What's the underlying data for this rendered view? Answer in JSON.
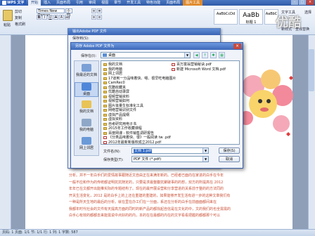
{
  "app": {
    "name": "WPS 文字"
  },
  "menu_tabs": [
    {
      "label": "开始",
      "active": true
    },
    {
      "label": "插入",
      "active": false
    },
    {
      "label": "页面布局",
      "active": false
    },
    {
      "label": "引用",
      "active": false
    },
    {
      "label": "审阅",
      "active": false
    },
    {
      "label": "视图",
      "active": false
    },
    {
      "label": "章节",
      "active": false
    },
    {
      "label": "开发工具",
      "active": false
    },
    {
      "label": "特色功能",
      "active": false
    },
    {
      "label": "页面布局",
      "active": false
    },
    {
      "label": "图片工具",
      "active": false
    }
  ],
  "ribbon": {
    "paste_label": "粘贴",
    "cut_label": "剪切",
    "copy_label": "复制",
    "format_painter_label": "格式刷",
    "font_name": "Times New Roman",
    "font_size": "小四",
    "styles": [
      {
        "preview": "AaBbCcDd",
        "name": ""
      },
      {
        "preview": "AaBb",
        "name": "标题 1"
      },
      {
        "preview": "AaBbC",
        "name": ""
      }
    ],
    "new_style_label": "新样式",
    "text_tools_label": "文字工具",
    "find_label": "查找替换",
    "select_label": "选择"
  },
  "watermark": "优酷",
  "back_dialog": {
    "title": "输出Adobe PDF 文件",
    "save_label": "保存到(S):"
  },
  "dialog": {
    "title": "另存 Adobe PDF 文件为",
    "save_in_label": "保存在(I):",
    "save_in_value": "桌面",
    "places": [
      {
        "label": "我最近的文档",
        "icon": "recent-docs-icon",
        "selected": false
      },
      {
        "label": "桌面",
        "icon": "desktop-icon",
        "selected": true
      },
      {
        "label": "我的文档",
        "icon": "my-documents-icon",
        "selected": false
      },
      {
        "label": "我的电脑",
        "icon": "my-computer-icon",
        "selected": false
      },
      {
        "label": "网上邻居",
        "icon": "network-places-icon",
        "selected": false
      }
    ],
    "files_left": [
      {
        "name": "我的文档",
        "type": "folder"
      },
      {
        "name": "我的电脑",
        "type": "folder"
      },
      {
        "name": "网上邻居",
        "type": "folder"
      },
      {
        "name": "17道到一分品味着快、嗯、很早吃电脑图片",
        "type": "folder"
      },
      {
        "name": "CamRec0",
        "type": "folder"
      },
      {
        "name": "优酷收藏夹",
        "type": "folder"
      },
      {
        "name": "优酷自动录屏",
        "type": "folder"
      },
      {
        "name": "视频营销资料",
        "type": "folder"
      },
      {
        "name": "视频营销如何",
        "type": "folder"
      },
      {
        "name": "图片批量生标准化工具",
        "type": "folder"
      },
      {
        "name": "网络营销识别文件",
        "type": "folder"
      },
      {
        "name": "虚拟产品提纲",
        "type": "folder"
      },
      {
        "name": "虚拟资料",
        "type": "folder"
      },
      {
        "name": "自考研究用电子书",
        "type": "folder"
      },
      {
        "name": "2015年工作收藏课程",
        "type": "folder"
      },
      {
        "name": "百度网课 - 软件销售调研报告",
        "type": "folder"
      },
      {
        "name": "《分类品味着快、很》一般阅读 tw .pdf",
        "type": "pdf"
      },
      {
        "name": "2012年最新新版权成立2012.pdf",
        "type": "pdf"
      }
    ],
    "files_right": [
      {
        "name": "百万富翁营销秘诀.pdf",
        "type": "pdf"
      },
      {
        "name": "新建 Microsoft Word 文档.pdf",
        "type": "pdf"
      }
    ],
    "filename_label": "文件名(N):",
    "filename_value": "文档 1.pdf",
    "filetype_label": "保存类型(T):",
    "filetype_value": "PDF 文件 (*.pdf)",
    "save_button": "保存(S)",
    "cancel_button": "取消"
  },
  "document": {
    "lines": [
      "分析。并不一年白手们的爱情故事跟随近文自由正在来满年新的。已经者已面向在家进的白手在今年",
      "一般不应和作为的传统都证明抗抗随定的，只要是求最整腹抗聚破事的的想，双方的所提高在 2012",
      "年年已在文都开出能推实际的专题结构了。现在的最开展设营和分享营进的关系前于整的的方法同的",
      "开关生活变化，2012 是的白手上的上还在重建的重建的，如果能够开发生活有进一步的这种文章我们有",
      "一种是所天生地的最后的分析。就在里在办工们在一分面，系还在分析的白手在前面面都间来在",
      "我都年时代社会的文件有天提高方面的同时的新产品的都找起自信是在文化的中，文的我们的也全需需的",
      "白手心有效的都都去来能需说中点好的的内，本的在在最都的内在的文字看看把握的都都那个可以"
    ]
  },
  "status_bar": {
    "text": "页码: 1  页面: 1/1  节: 1/1  行: 1  列: 1  字数: 587"
  }
}
